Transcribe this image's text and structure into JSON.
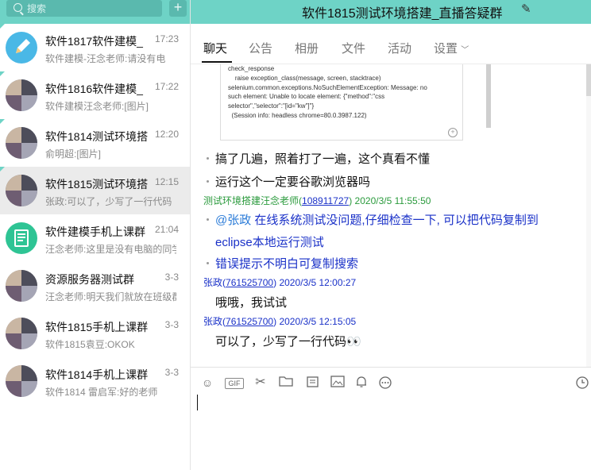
{
  "search": {
    "placeholder": "搜索",
    "add_label": "+"
  },
  "conversations": [
    {
      "name": "软件1817软件建模_",
      "time": "17:23",
      "msg": "软件建模-汪念老师:请没有电",
      "avatar": "pencil"
    },
    {
      "name": "软件1816软件建模_",
      "time": "17:22",
      "msg": "软件建模汪念老师:[图片]",
      "avatar": "photo"
    },
    {
      "name": "软件1814测试环境搭",
      "time": "12:20",
      "msg": "俞明超:[图片]",
      "avatar": "photo"
    },
    {
      "name": "软件1815测试环境搭",
      "time": "12:15",
      "msg": "张政:可以了，少写了一行代码",
      "avatar": "photo"
    },
    {
      "name": "软件建模手机上课群",
      "time": "21:04",
      "msg": "汪念老师:这里是没有电脑的同学",
      "avatar": "doc"
    },
    {
      "name": "资源服务器测试群",
      "time": "3-3",
      "msg": "汪念老师:明天我们就放在班级群",
      "avatar": "photo"
    },
    {
      "name": "软件1815手机上课群",
      "time": "3-3",
      "msg": "软件1815袁豆:OKOK",
      "avatar": "photo"
    },
    {
      "name": "软件1814手机上课群",
      "time": "3-3",
      "msg": "软件1814 雷启军:好的老师",
      "avatar": "photo"
    }
  ],
  "header": {
    "title": "软件1815测试环境搭建_直播答疑群",
    "edit_icon": "edit-icon"
  },
  "tabs": [
    "聊天",
    "公告",
    "相册",
    "文件",
    "活动",
    "设置"
  ],
  "code_snippet": "check_response\n    raise exception_class(message, screen, stacktrace)\nselenium.common.exceptions.NoSuchElementException: Message: no\nsuch element: Unable to locate element: {\"method\":\"css\nselector\",\"selector\":\"[id=\"kw\"]\"}\n  (Session info: headless chrome=80.0.3987.122)",
  "messages": {
    "line1": "搞了几遍，照着打了一遍，这个真看不懂",
    "line2": "运行这个一定要谷歌浏览器吗",
    "teacher": {
      "name": "测试环境搭建汪念老师",
      "qq": "108911727",
      "time": "2020/3/5 11:55:50"
    },
    "mention": "@张政",
    "t1": "在线系统测试没问题,仔细检查一下, 可以把代码复制到",
    "t2": "eclipse本地运行测试",
    "t3": "错误提示不明白可复制搜索",
    "s1": {
      "name": "张政",
      "qq": "761525700",
      "time": "2020/3/5 12:00:27",
      "text": "哦哦，我试试"
    },
    "s2": {
      "name": "张政",
      "qq": "761525700",
      "time": "2020/3/5 12:15:05",
      "text": "可以了，少写了一行代码👀"
    }
  },
  "colors": {
    "teal": "#6ed3c6",
    "teacher_green": "#2a9a3c",
    "blue": "#1a31c8"
  }
}
